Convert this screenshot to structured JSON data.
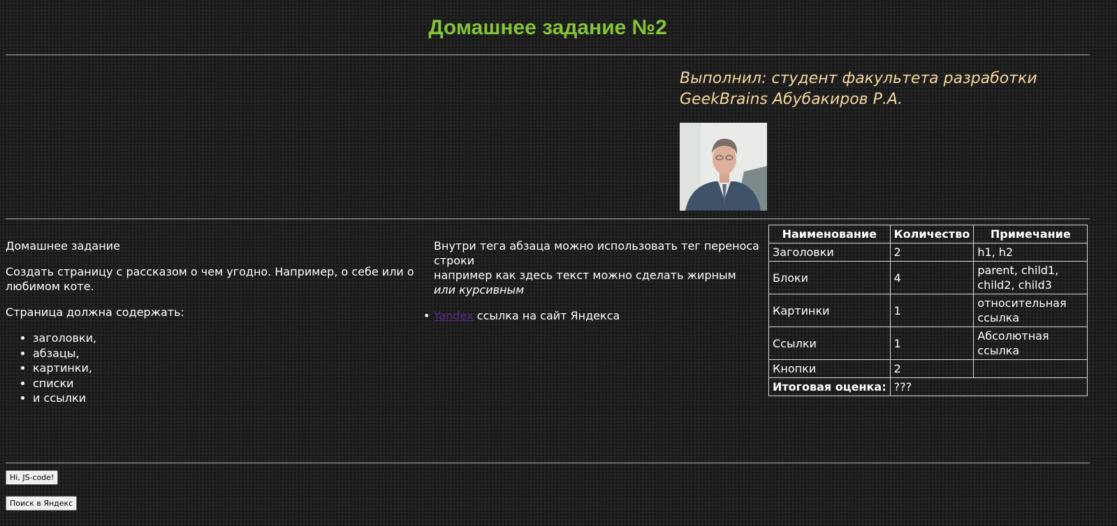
{
  "title": "Домашнее задание №2",
  "author": {
    "line1": "Выполнил: студент факультета разработки",
    "line2": "GeekBrains Абубакиров Р.А."
  },
  "left": {
    "heading": "Домашнее задание",
    "description": "Создать страницу с рассказом о чем угодно. Например, о себе или о любимом коте.",
    "must_contain": "Страница должна содержать:",
    "items": [
      "заголовки,",
      "абзацы,",
      "картинки,",
      "списки",
      "и ссылки"
    ]
  },
  "middle": {
    "line1": "Внутри тега абзаца можно использовать тег переноса строки",
    "line2": "например как здесь текст можно сделать жирным",
    "line3": "или курсивным",
    "link_text": "Yandex",
    "link_desc": " ссылка на сайт Яндекса"
  },
  "table": {
    "headers": [
      "Наименование",
      "Количество",
      "Примечание"
    ],
    "rows": [
      {
        "name": "Заголовки",
        "count": "2",
        "note": "h1, h2"
      },
      {
        "name": "Блоки",
        "count": "4",
        "note": "parent, child1, child2, child3"
      },
      {
        "name": "Картинки",
        "count": "1",
        "note": "относительная ссылка"
      },
      {
        "name": "Ссылки",
        "count": "1",
        "note": "Абсолютная ссылка"
      },
      {
        "name": "Кнопки",
        "count": "2",
        "note": ""
      }
    ],
    "total_label": "Итоговая оценка:",
    "total_value": "???"
  },
  "buttons": {
    "js": "Hi, JS-code!",
    "search": "Поиск в Яндекс"
  }
}
